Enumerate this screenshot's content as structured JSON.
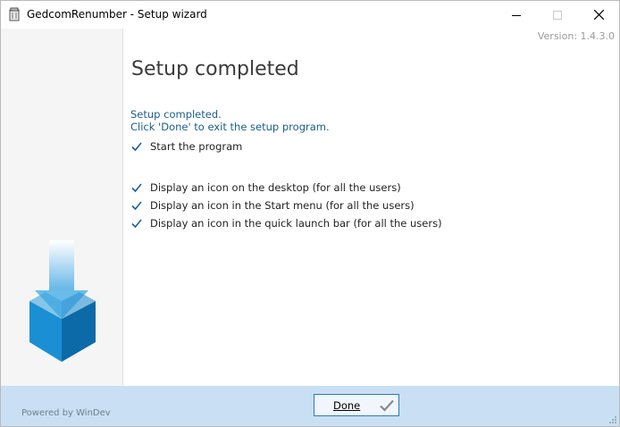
{
  "window": {
    "title": "GedcomRenumber - Setup wizard"
  },
  "header": {
    "version": "Version: 1.4.3.0",
    "page_title": "Setup completed"
  },
  "message": {
    "line1": "Setup completed.",
    "line2": "Click 'Done' to exit the setup program."
  },
  "options": {
    "start_program": {
      "label": "Start the program",
      "checked": true
    },
    "desktop_icon": {
      "label": "Display an icon on the desktop (for all the users)",
      "checked": true
    },
    "start_menu_icon": {
      "label": "Display an icon in the Start menu (for all the users)",
      "checked": true
    },
    "quick_launch_icon": {
      "label": "Display an icon in the quick launch bar (for all the users)",
      "checked": true
    }
  },
  "footer": {
    "powered_by": "Powered by WinDev",
    "done_label": "Done"
  },
  "colors": {
    "accent": "#1a5f8c",
    "footer_bg": "#c9e0f4",
    "button_border": "#2a78c2",
    "check_color": "#1d5fa0"
  },
  "icons": {
    "app": "package-icon",
    "minimize": "minimize-icon",
    "maximize": "maximize-icon",
    "close": "close-icon",
    "setup_graphic": "download-box-icon",
    "done_check": "checkmark-icon"
  }
}
